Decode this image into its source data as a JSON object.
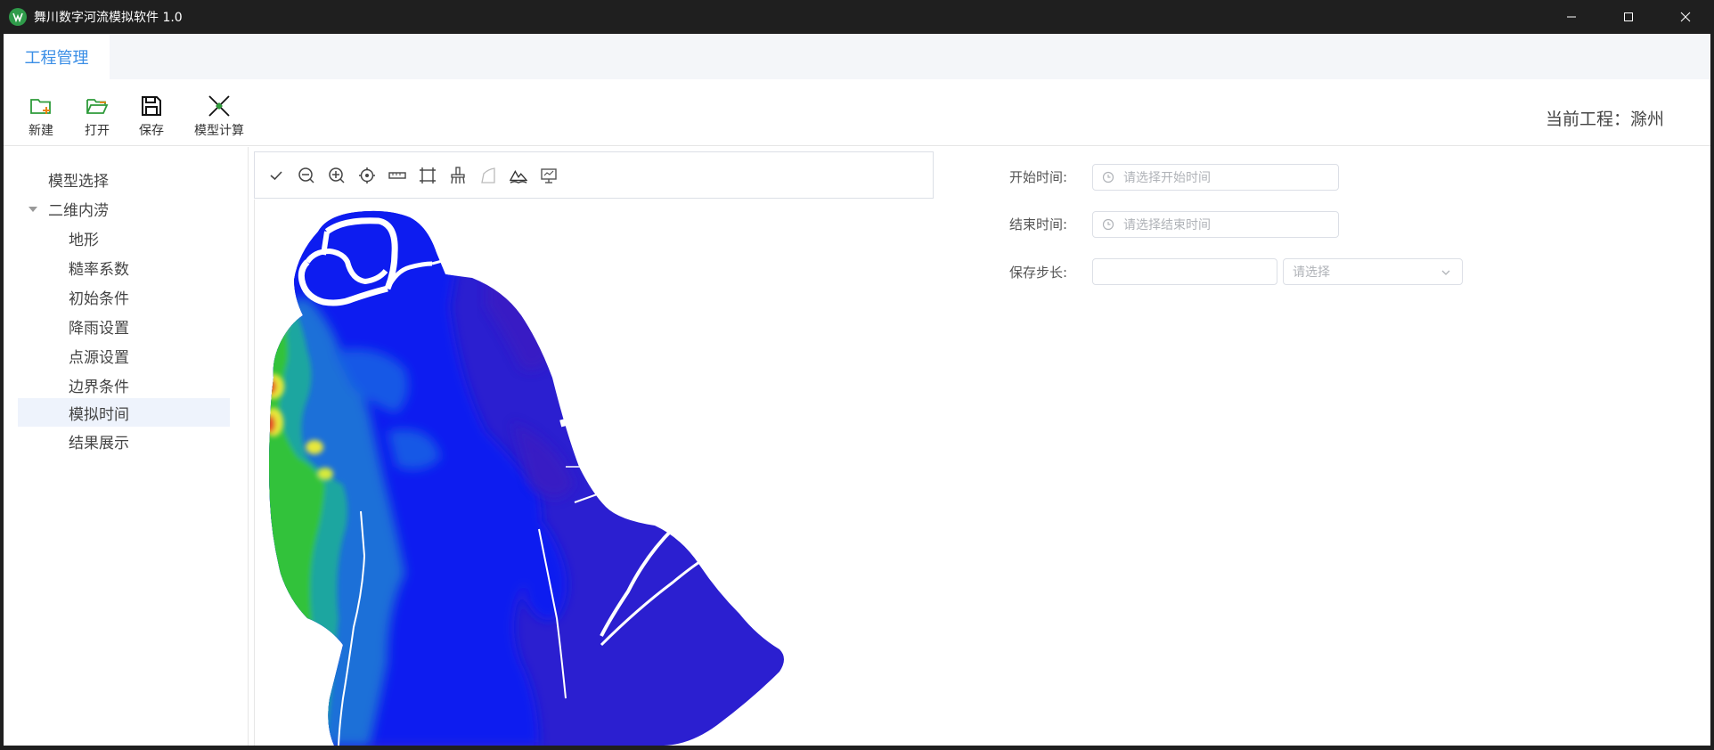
{
  "window": {
    "title": "舞川数字河流模拟软件 1.0"
  },
  "menu": {
    "active_tab": "工程管理"
  },
  "toolbar": {
    "new_label": "新建",
    "open_label": "打开",
    "save_label": "保存",
    "compute_label": "模型计算",
    "current_project": "当前工程：滁州"
  },
  "tree": {
    "items": [
      {
        "label": "模型选择",
        "level": 0
      },
      {
        "label": "二维内涝",
        "level": 0,
        "expanded": true
      },
      {
        "label": "地形",
        "level": 1
      },
      {
        "label": "糙率系数",
        "level": 1
      },
      {
        "label": "初始条件",
        "level": 1
      },
      {
        "label": "降雨设置",
        "level": 1
      },
      {
        "label": "点源设置",
        "level": 1
      },
      {
        "label": "边界条件",
        "level": 1
      },
      {
        "label": "模拟时间",
        "level": 1,
        "selected": true
      },
      {
        "label": "结果展示",
        "level": 1
      }
    ]
  },
  "map_toolbar": {
    "icons": [
      "check-icon",
      "zoom-out-icon",
      "zoom-in-icon",
      "locate-icon",
      "measure-icon",
      "full-extent-icon",
      "clear-icon",
      "polygon-icon",
      "terrain-icon",
      "screen-icon"
    ]
  },
  "form": {
    "start_label": "开始时间:",
    "start_placeholder": "请选择开始时间",
    "end_label": "结束时间:",
    "end_placeholder": "请选择结束时间",
    "step_label": "保存步长:",
    "step_value": "",
    "step_unit_placeholder": "请选择"
  },
  "colors": {
    "accent": "#3a8ee6",
    "titlebar": "#1f1f1f",
    "map_deep": "#2b1fd0",
    "map_blue": "#0a1ff0",
    "map_teal": "#1a7ad0",
    "map_green": "#2ec43a",
    "map_yellow": "#e8e83a",
    "map_red": "#e33a2a"
  }
}
